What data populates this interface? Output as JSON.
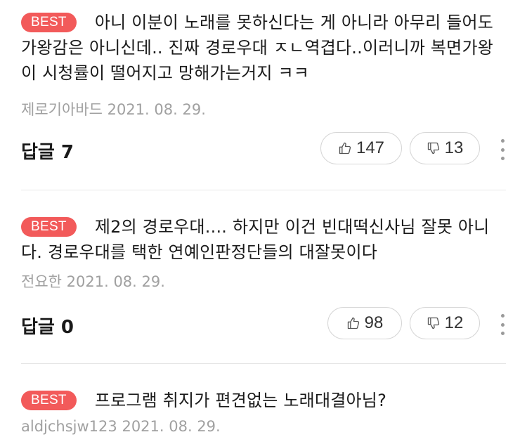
{
  "comments": [
    {
      "badge": "BEST",
      "text": "아니 이분이 노래를 못하신다는 게 아니라 아무리 들어도 가왕감은 아니신데.. 진짜 경로우대 ㅈㄴ역겹다..이러니까 복면가왕이 시청률이 떨어지고 망해가는거지 ㅋㅋ",
      "author": "제로기아바드",
      "date": "2021. 08. 29.",
      "reply_label": "답글 7",
      "likes": "147",
      "dislikes": "13"
    },
    {
      "badge": "BEST",
      "text": "제2의 경로우대....  하지만 이건 빈대떡신사님 잘못 아니다. 경로우대를 택한 연예인판정단들의 대잘못이다",
      "author": "전요한",
      "date": "2021. 08. 29.",
      "reply_label": "답글 0",
      "likes": "98",
      "dislikes": "12"
    },
    {
      "badge": "BEST",
      "text": "프로그램 취지가 편견없는 노래대결아님?",
      "author": "aldjchsjw123",
      "date": "2021. 08. 29."
    }
  ],
  "icons": {
    "like": "thumbs-up-icon",
    "dislike": "thumbs-down-icon",
    "more": "more-vertical-icon"
  },
  "colors": {
    "badge_bg": "#f25a5a",
    "meta_text": "#a0a0a0",
    "button_border": "#d6d6d6"
  }
}
